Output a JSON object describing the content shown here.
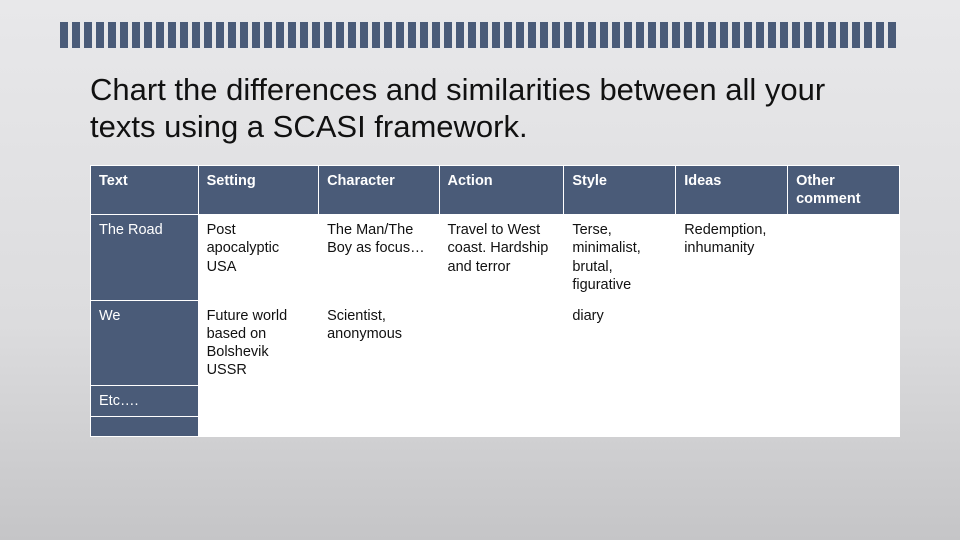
{
  "title": "Chart the differences and similarities between all your texts using a SCASI framework.",
  "chart_data": {
    "type": "table",
    "columns": [
      "Text",
      "Setting",
      "Character",
      "Action",
      "Style",
      "Ideas",
      "Other comment"
    ],
    "rows": [
      {
        "text": "The Road",
        "setting": "Post apocalyptic USA",
        "character": "The Man/The Boy as focus…",
        "action": "Travel to West coast. Hardship and terror",
        "style": "Terse, minimalist, brutal, figurative",
        "ideas": "Redemption, inhumanity",
        "other": ""
      },
      {
        "text": "We",
        "setting": "Future world based on Bolshevik USSR",
        "character": "Scientist, anonymous",
        "action": "",
        "style": "diary",
        "ideas": "",
        "other": ""
      },
      {
        "text": "Etc….",
        "setting": "",
        "character": "",
        "action": "",
        "style": "",
        "ideas": "",
        "other": ""
      },
      {
        "text": "",
        "setting": "",
        "character": "",
        "action": "",
        "style": "",
        "ideas": "",
        "other": ""
      }
    ]
  }
}
